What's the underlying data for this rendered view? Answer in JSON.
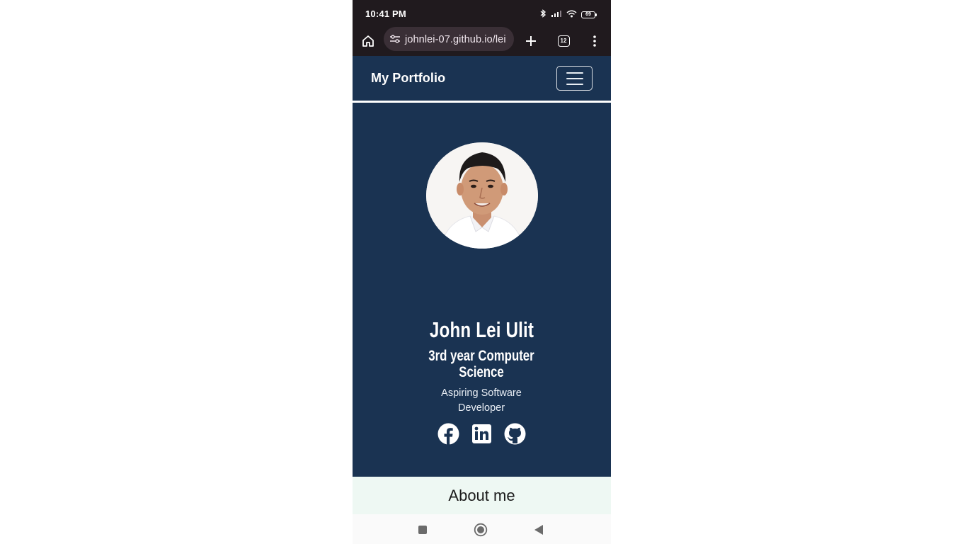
{
  "status_bar": {
    "time": "10:41 PM",
    "battery": "69",
    "icons": [
      "bluetooth-icon",
      "signal-icon",
      "wifi-icon",
      "battery-icon"
    ]
  },
  "browser": {
    "url": "johnlei-07.github.io/lei",
    "tab_count": "12",
    "icons": [
      "home-icon",
      "site-settings-icon",
      "plus-icon",
      "tabs-icon",
      "more-icon"
    ]
  },
  "site_nav": {
    "brand": "My Portfolio",
    "toggler_icon": "hamburger-icon"
  },
  "hero": {
    "name": "John Lei Ulit",
    "title": "3rd year Computer Science",
    "subtitle": "Aspiring Software Developer",
    "socials": [
      "facebook-icon",
      "linkedin-icon",
      "github-icon"
    ]
  },
  "about": {
    "title": "About me"
  },
  "system_nav": [
    "recents-icon",
    "home-circle-icon",
    "back-icon"
  ],
  "colors": {
    "navy": "#1a3352",
    "status_bar": "#201a1e",
    "about_bg": "#eef8f3"
  }
}
